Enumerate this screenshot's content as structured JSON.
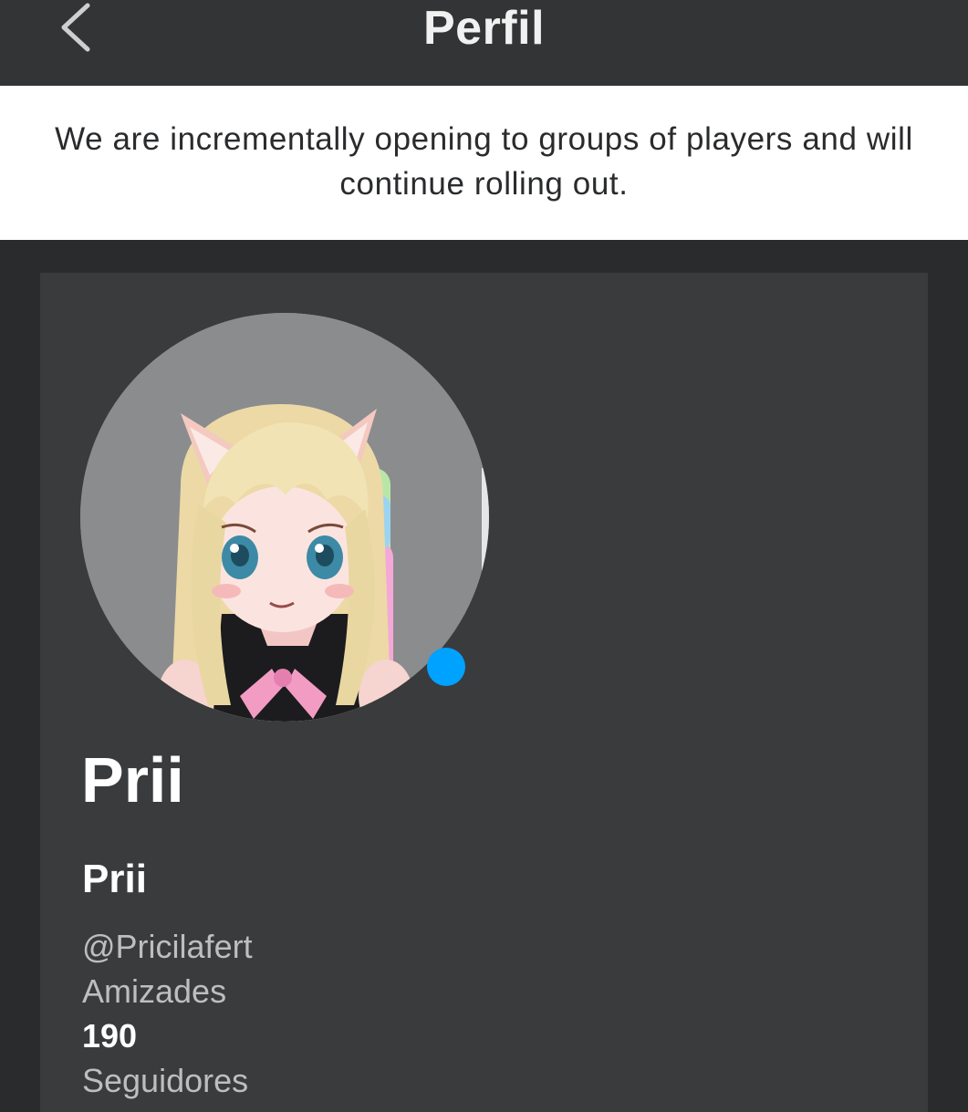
{
  "header": {
    "title": "Perfil",
    "back_icon": "chevron-left-icon"
  },
  "banner": {
    "message": "We are incrementally opening to groups of players and will continue rolling out."
  },
  "profile": {
    "avatar_description_icon": "avatar-image",
    "presence_status_color": "#00a2ff",
    "display_name": "Prii",
    "name": "Prii",
    "username": "@Pricilafert",
    "friends_label": "Amizades",
    "friends_count": "190",
    "followers_label": "Seguidores"
  },
  "colors": {
    "topbar": "#333435",
    "background": "#2a2b2d",
    "card": "#393b3d",
    "accent": "#00a2ff"
  }
}
